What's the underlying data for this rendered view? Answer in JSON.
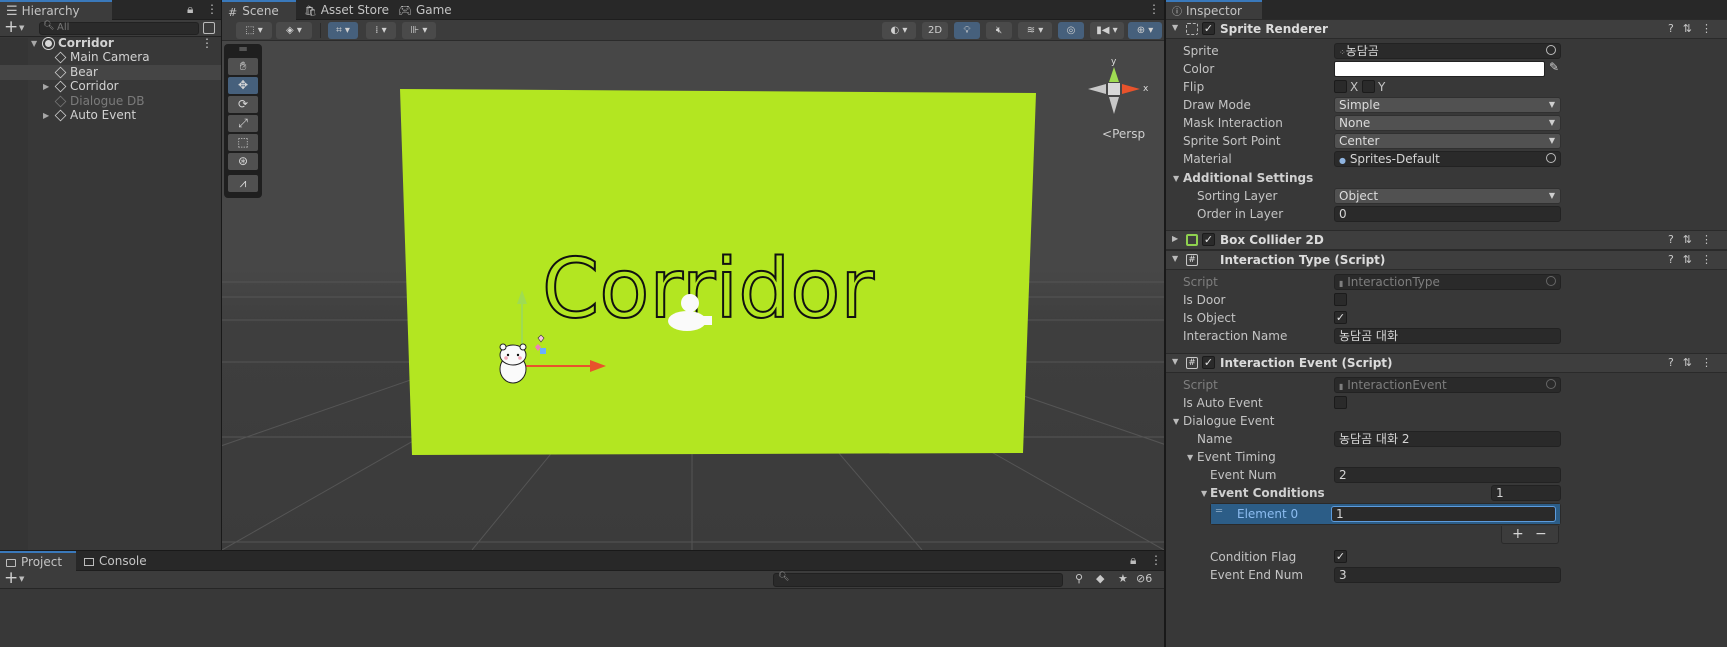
{
  "hierarchy": {
    "tab_label": "Hierarchy",
    "search_placeholder": "All",
    "items": [
      {
        "label": "Corridor"
      },
      {
        "label": "Main Camera"
      },
      {
        "label": "Bear"
      },
      {
        "label": "Corridor"
      },
      {
        "label": "Dialogue DB"
      },
      {
        "label": "Auto Event"
      }
    ]
  },
  "scene": {
    "tabs": [
      {
        "label": "Scene"
      },
      {
        "label": "Asset Store"
      },
      {
        "label": "Game"
      }
    ],
    "toolbar": {
      "mode_2d": "2D"
    },
    "gizmo": {
      "y_label": "y",
      "x_label": "x",
      "projection": "Persp"
    },
    "canvas_text": "Corridor",
    "colors": {
      "wall": "#b3e621",
      "handle_x": "#e8532c",
      "handle_y": "#9fdc52"
    }
  },
  "inspector": {
    "tab_label": "Inspector",
    "sprite_renderer": {
      "title": "Sprite Renderer",
      "sprite_label": "Sprite",
      "sprite_value": "농담곰",
      "color_label": "Color",
      "color_value": "#ffffff",
      "flip_label": "Flip",
      "flip_x": "X",
      "flip_y": "Y",
      "draw_mode_label": "Draw Mode",
      "draw_mode_value": "Simple",
      "mask_label": "Mask Interaction",
      "mask_value": "None",
      "sort_point_label": "Sprite Sort Point",
      "sort_point_value": "Center",
      "material_label": "Material",
      "material_value": "Sprites-Default",
      "additional_label": "Additional Settings",
      "sorting_layer_label": "Sorting Layer",
      "sorting_layer_value": "Object",
      "order_label": "Order in Layer",
      "order_value": "0"
    },
    "box_collider": {
      "title": "Box Collider 2D"
    },
    "interaction_type": {
      "title": "Interaction Type (Script)",
      "script_label": "Script",
      "script_value": "InteractionType",
      "is_door_label": "Is Door",
      "is_door": false,
      "is_object_label": "Is Object",
      "is_object": true,
      "name_label": "Interaction Name",
      "name_value": "농담곰 대화"
    },
    "interaction_event": {
      "title": "Interaction Event (Script)",
      "script_label": "Script",
      "script_value": "InteractionEvent",
      "auto_label": "Is Auto Event",
      "dialogue_label": "Dialogue Event",
      "name_label": "Name",
      "name_value": "농담곰 대화 2",
      "timing_label": "Event Timing",
      "event_num_label": "Event Num",
      "event_num_value": "2",
      "conditions_label": "Event Conditions",
      "conditions_count": "1",
      "element_label": "Element 0",
      "element_value": "1",
      "flag_label": "Condition Flag",
      "end_num_label": "Event End Num",
      "end_num_value": "3"
    }
  },
  "bottom": {
    "tabs": [
      {
        "label": "Project"
      },
      {
        "label": "Console"
      }
    ],
    "hidden_count": "6"
  }
}
